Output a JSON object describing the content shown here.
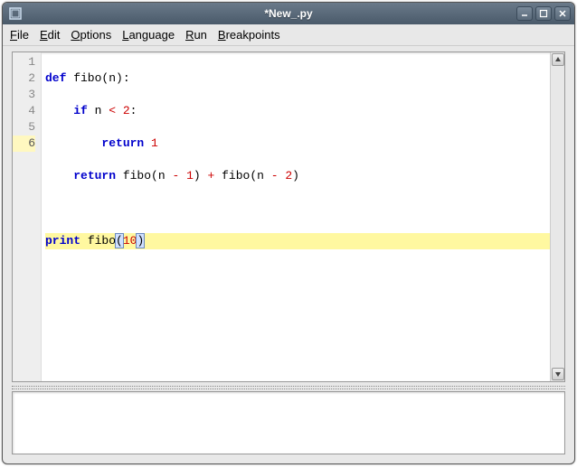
{
  "window": {
    "title": "*New_.py"
  },
  "menu": {
    "file": "File",
    "edit": "Edit",
    "options": "Options",
    "language": "Language",
    "run": "Run",
    "breakpoints": "Breakpoints"
  },
  "gutter": {
    "l1": "1",
    "l2": "2",
    "l3": "3",
    "l4": "4",
    "l5": "5",
    "l6": "6"
  },
  "code": {
    "line1": {
      "kw": "def",
      "rest": " fibo(n):"
    },
    "line2": {
      "indent": "    ",
      "kw": "if",
      "rest_a": " n ",
      "op": "<",
      "rest_b": " ",
      "num": "2",
      "end": ":"
    },
    "line3": {
      "indent": "        ",
      "kw": "return",
      "sp": " ",
      "num": "1"
    },
    "line4": {
      "indent": "    ",
      "kw": "return",
      "rest_a": " fibo(n ",
      "op1": "-",
      "sp1": " ",
      "num1": "1",
      "mid": ") ",
      "op2": "+",
      "rest_b": " fibo(n ",
      "op3": "-",
      "sp2": " ",
      "num2": "2",
      "end": ")"
    },
    "line6": {
      "kw": "print",
      "sp": " ",
      "fn": "fibo",
      "paren_l": "(",
      "num": "10",
      "paren_r": ")"
    }
  },
  "editor": {
    "current_line": 6,
    "cursor_column": 11
  }
}
